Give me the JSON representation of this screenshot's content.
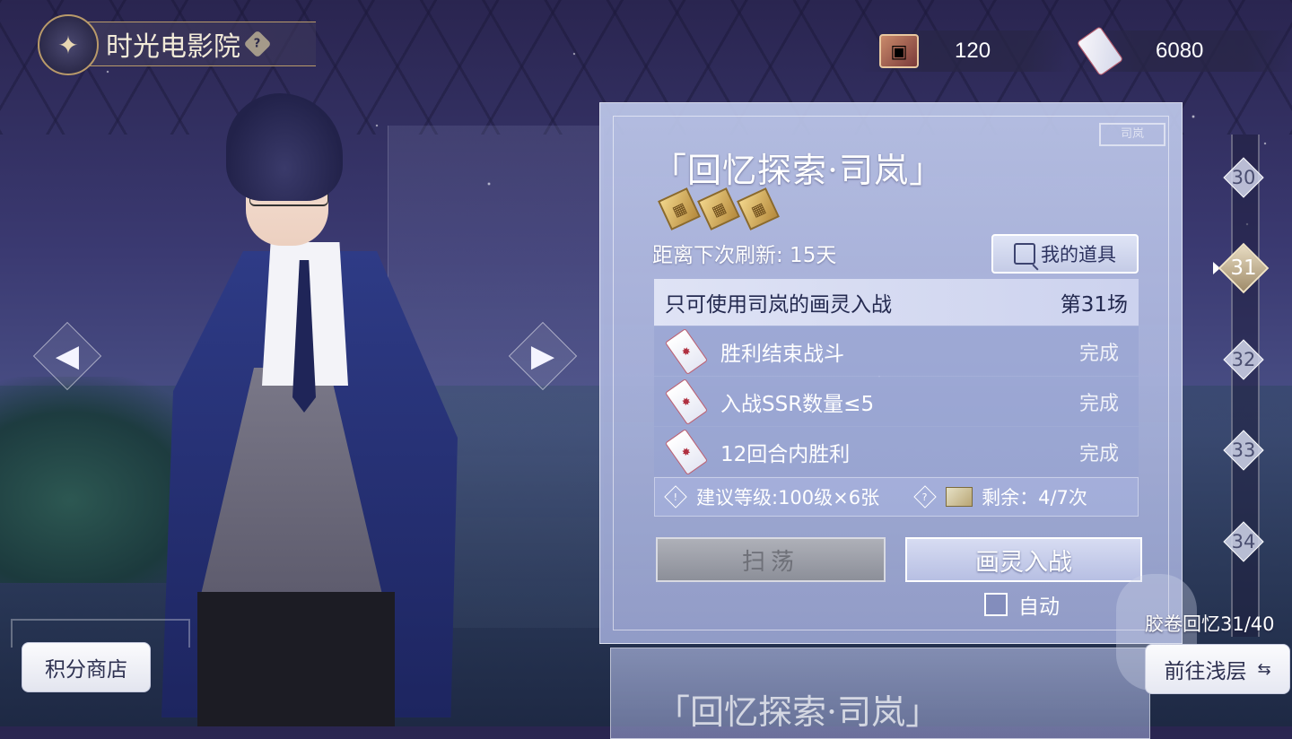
{
  "header": {
    "title": "时光电影院",
    "help_glyph": "?",
    "logo_icon": "butterfly-icon"
  },
  "currency": [
    {
      "icon": "film-card-icon",
      "value": "120"
    },
    {
      "icon": "ticket-icon",
      "value": "6080"
    }
  ],
  "stage": {
    "title": "「回忆探索·司岚」",
    "stamp": "司岚",
    "film_rating_count": 3,
    "refresh_text": "距离下次刷新: 15天",
    "items_button_label": "我的道具",
    "rule_header": "只可使用司岚的画灵入战",
    "round_label": "第31场",
    "conditions": [
      {
        "text": "胜利结束战斗",
        "status": "完成"
      },
      {
        "text": "入战SSR数量≤5",
        "status": "完成"
      },
      {
        "text": "12回合内胜利",
        "status": "完成"
      }
    ],
    "recommend_text": "建议等级:100级×6张",
    "remaining_text": "剩余：4/7次",
    "sweep_label": "扫荡",
    "battle_label": "画灵入战",
    "auto_label": "自动",
    "auto_checked": false
  },
  "next_stage": {
    "title": "「回忆探索·司岚」"
  },
  "levels": {
    "items": [
      "30",
      "31",
      "32",
      "33",
      "34"
    ],
    "active": "31"
  },
  "progress": {
    "label": "胶卷回忆31/40"
  },
  "buttons": {
    "shop_label": "积分商店",
    "goto_label": "前往浅层",
    "goto_icon": "swap-arrows-icon"
  },
  "colors": {
    "panel": "#b6bde3",
    "accent_gold": "#b99a6a",
    "sweep_disabled": "#8c8f99"
  }
}
